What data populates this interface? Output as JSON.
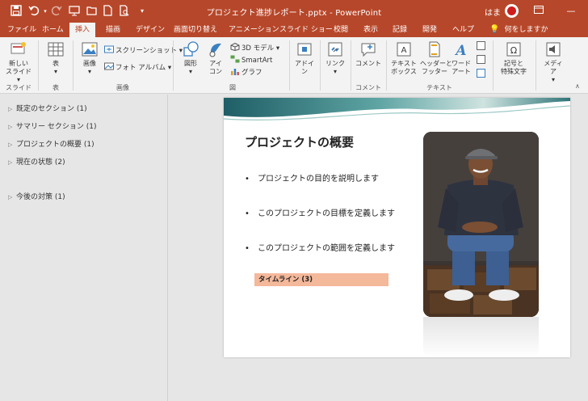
{
  "window": {
    "title": "プロジェクト進捗レポート.pptx - PowerPoint",
    "user": "はま"
  },
  "quick_access": [
    "save-icon",
    "undo-icon",
    "redo-icon",
    "present-icon",
    "open-icon",
    "new-icon",
    "print-preview-icon",
    "customize-icon"
  ],
  "tabs": [
    {
      "label": "ファイル"
    },
    {
      "label": "ホーム"
    },
    {
      "label": "挿入"
    },
    {
      "label": "描画"
    },
    {
      "label": "デザイン"
    },
    {
      "label": "画面切り替え"
    },
    {
      "label": "アニメーション"
    },
    {
      "label": "スライド ショー"
    },
    {
      "label": "校閲"
    },
    {
      "label": "表示"
    },
    {
      "label": "記録"
    },
    {
      "label": "開発"
    },
    {
      "label": "ヘルプ"
    }
  ],
  "tell_me": "何をしますか",
  "ribbon": {
    "new_slide": "新しい\nスライド",
    "table": "表",
    "images": "画像",
    "screenshot": "スクリーンショット",
    "photo_album": "フォト アルバム",
    "shapes": "図形",
    "icons": "アイ\nコン",
    "model3d": "3D モデル",
    "smartart": "SmartArt",
    "chart": "グラフ",
    "addins": "アドイ\nン",
    "link": "リンク",
    "comment": "コメント",
    "textbox": "テキスト\nボックス",
    "header_footer": "ヘッダーと\nフッター",
    "wordart": "ワード\nアート",
    "symbols": "記号と\n特殊文字",
    "media": "メディア",
    "groups": {
      "slides": "スライド",
      "tables": "表",
      "images": "画像",
      "illustrations": "図",
      "comments": "コメント",
      "text": "テキスト"
    }
  },
  "sections": [
    {
      "label": "既定のセクション (1)"
    },
    {
      "label": "サマリー セクション (1)"
    },
    {
      "label": "プロジェクトの概要 (1)"
    },
    {
      "label": "現在の状態 (2)"
    },
    {
      "label": "今後の対策 (1)"
    }
  ],
  "slide": {
    "title": "プロジェクトの概要",
    "bullets": [
      "プロジェクトの目的を説明します",
      "このプロジェクトの目標を定義します",
      "このプロジェクトの範囲を定義します"
    ],
    "timeline": "タイムライン (3)"
  },
  "colors": {
    "accent": "#b7472a",
    "timeline_fill": "#f4b89a",
    "banner_teal": "#2f7478"
  }
}
